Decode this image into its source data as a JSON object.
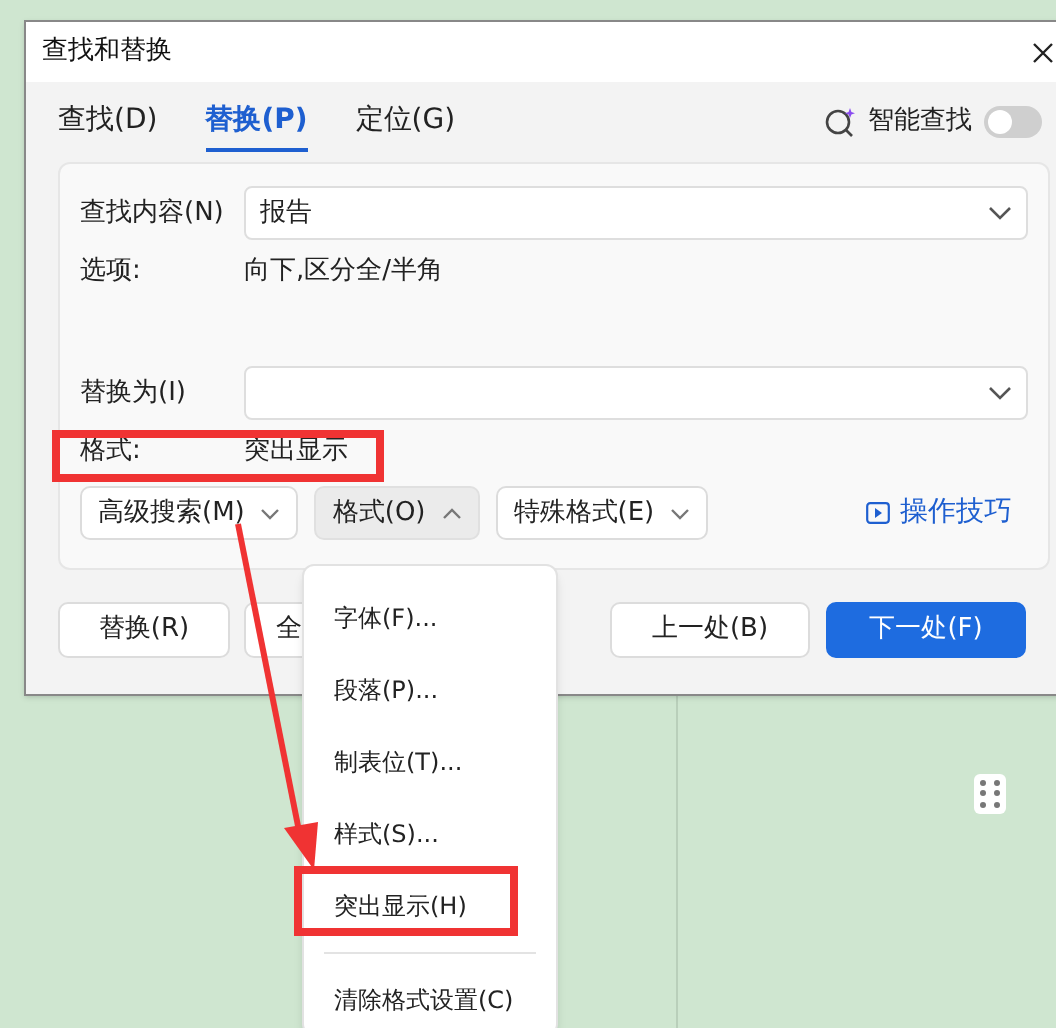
{
  "dialog": {
    "title": "查找和替换"
  },
  "tabs": [
    {
      "label": "查找(D)",
      "selected": false
    },
    {
      "label": "替换(P)",
      "selected": true
    },
    {
      "label": "定位(G)",
      "selected": false
    }
  ],
  "smart_search": {
    "label": "智能查找",
    "on": false
  },
  "find": {
    "label": "查找内容(N)",
    "value": "报告"
  },
  "options": {
    "label": "选项:",
    "value": "向下,区分全/半角"
  },
  "replace": {
    "label": "替换为(I)"
  },
  "format": {
    "label": "格式:",
    "value": "突出显示"
  },
  "option_buttons": [
    {
      "label": "高级搜索(M)",
      "open": false
    },
    {
      "label": "格式(O)",
      "open": true
    },
    {
      "label": "特殊格式(E)",
      "open": false
    }
  ],
  "tips_link": "操作技巧",
  "action_buttons": [
    {
      "label": "替换(R)",
      "kind": "default"
    },
    {
      "label": "全",
      "kind": "default"
    },
    {
      "label": "上一处(B)",
      "kind": "default"
    },
    {
      "label": "下一处(F)",
      "kind": "primary"
    }
  ],
  "format_menu": [
    {
      "label": "字体(F)...",
      "divider_before": false
    },
    {
      "label": "段落(P)...",
      "divider_before": false
    },
    {
      "label": "制表位(T)...",
      "divider_before": false
    },
    {
      "label": "样式(S)...",
      "divider_before": false
    },
    {
      "label": "突出显示(H)",
      "divider_before": false
    },
    {
      "label": "清除格式设置(C)",
      "divider_before": true
    }
  ]
}
